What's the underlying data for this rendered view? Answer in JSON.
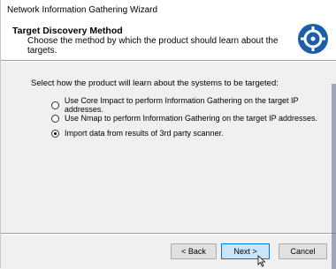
{
  "window": {
    "title": "Network Information Gathering Wizard"
  },
  "header": {
    "title": "Target Discovery Method",
    "description": "Choose the method by which the product should learn about the targets.",
    "logo_icon": "crosshair-target-icon"
  },
  "content": {
    "instruction": "Select how the product will learn about the systems to be targeted:",
    "options": [
      {
        "label": "Use Core Impact to perform Information Gathering on the target IP addresses.",
        "checked": false
      },
      {
        "label": "Use Nmap to perform Information Gathering on the target IP addresses.",
        "checked": false
      },
      {
        "label": "Import data from results of 3rd party scanner.",
        "checked": true
      }
    ]
  },
  "footer": {
    "back_label": "< Back",
    "next_label": "Next >",
    "cancel_label": "Cancel"
  },
  "colors": {
    "accent": "#0078d7",
    "logo_blue": "#1a5fa8"
  }
}
